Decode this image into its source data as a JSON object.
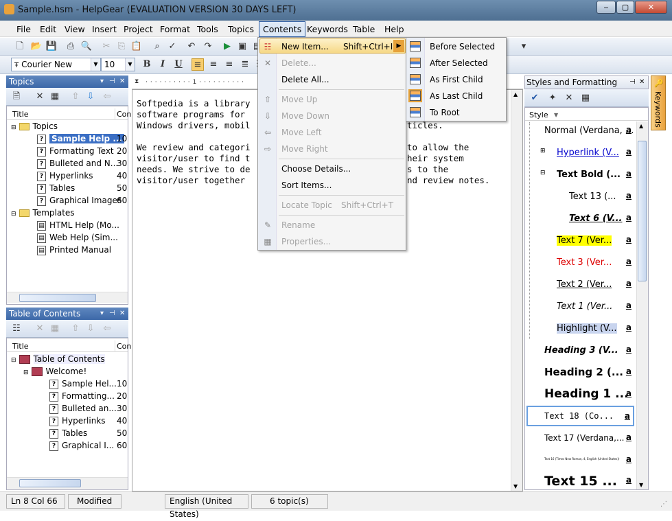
{
  "window": {
    "title": "Sample.hsm - HelpGear (EVALUATION VERSION 30 DAYS LEFT)",
    "min": "‒",
    "max": "▢",
    "close": "✕"
  },
  "menubar": [
    "File",
    "Edit",
    "View",
    "Insert",
    "Project",
    "Format",
    "Tools",
    "Topics",
    "Contents",
    "Keywords",
    "Table",
    "Help"
  ],
  "format_toolbar": {
    "font": "Courier New",
    "size": "10",
    "bold": "B",
    "italic": "I",
    "underline": "U"
  },
  "topics_panel": {
    "title": "Topics",
    "col_title": "Title",
    "col_con": "Con",
    "items": [
      {
        "label": "Topics",
        "num": ""
      },
      {
        "label": "Sample Help ...",
        "num": "10"
      },
      {
        "label": "Formatting Text",
        "num": "20"
      },
      {
        "label": "Bulleted and N...",
        "num": "30"
      },
      {
        "label": "Hyperlinks",
        "num": "40"
      },
      {
        "label": "Tables",
        "num": "50"
      },
      {
        "label": "Graphical Images",
        "num": "60"
      },
      {
        "label": "Templates",
        "num": ""
      },
      {
        "label": "HTML Help (Mo...",
        "num": ""
      },
      {
        "label": "Web Help (Sim...",
        "num": ""
      },
      {
        "label": "Printed Manual",
        "num": ""
      }
    ]
  },
  "toc_panel": {
    "title": "Table of Contents",
    "col_title": "Title",
    "col_con": "Con",
    "items": [
      {
        "label": "Table of Contents",
        "num": ""
      },
      {
        "label": "Welcome!",
        "num": ""
      },
      {
        "label": "Sample Hel...",
        "num": "10"
      },
      {
        "label": "Formatting...",
        "num": "20"
      },
      {
        "label": "Bulleted an...",
        "num": "30"
      },
      {
        "label": "Hyperlinks",
        "num": "40"
      },
      {
        "label": "Tables",
        "num": "50"
      },
      {
        "label": "Graphical I...",
        "num": "60"
      }
    ]
  },
  "editor": {
    "lines": [
      "Softpedia is a library",
      "software programs for",
      "Windows drivers, mobil",
      "",
      "We review and categori",
      "visitor/user to find t",
      "needs. We strive to de",
      "visitor/user together "
    ],
    "right_lines": [
      {
        "row": 2,
        "text": "ticles."
      },
      {
        "row": 4,
        "text": "to allow the"
      },
      {
        "row": 5,
        "text": "heir system"
      },
      {
        "row": 6,
        "text": "s to the"
      },
      {
        "row": 7,
        "text": "nd review notes."
      }
    ]
  },
  "contents_menu": {
    "items": [
      {
        "label": "New Item...",
        "shortcut": "Shift+Ctrl+I",
        "disabled": false
      },
      {
        "label": "Delete...",
        "shortcut": "",
        "disabled": true
      },
      {
        "label": "Delete All...",
        "shortcut": "",
        "disabled": false
      },
      {
        "label": "Move Up",
        "shortcut": "",
        "disabled": true
      },
      {
        "label": "Move Down",
        "shortcut": "",
        "disabled": true
      },
      {
        "label": "Move Left",
        "shortcut": "",
        "disabled": true
      },
      {
        "label": "Move Right",
        "shortcut": "",
        "disabled": true
      },
      {
        "label": "Choose Details...",
        "shortcut": "",
        "disabled": false
      },
      {
        "label": "Sort Items...",
        "shortcut": "",
        "disabled": false
      },
      {
        "label": "Locate Topic",
        "shortcut": "Shift+Ctrl+T",
        "disabled": true
      },
      {
        "label": "Rename",
        "shortcut": "",
        "disabled": true
      },
      {
        "label": "Properties...",
        "shortcut": "",
        "disabled": true
      }
    ]
  },
  "new_item_submenu": [
    "Before Selected",
    "After Selected",
    "As First Child",
    "As Last Child",
    "To Root"
  ],
  "styles_panel": {
    "title": "Styles and Formatting",
    "col": "Style",
    "side_tab": "Keywords",
    "styles": [
      {
        "label": "Normal (Verdana, ...",
        "color": "#000000"
      },
      {
        "label": "Hyperlink (V...",
        "color": "#0000cc"
      },
      {
        "label": "Text Bold (...",
        "color": "#000000"
      },
      {
        "label": "Text 13 (...",
        "color": "#000000"
      },
      {
        "label": "Text 6 (V...",
        "color": "#000000"
      },
      {
        "label": "Text 7 (Ver...",
        "color": "#000000",
        "bg": "#ffff00"
      },
      {
        "label": "Text 3 (Ver...",
        "color": "#dd0000"
      },
      {
        "label": "Text 2 (Ver...",
        "color": "#000000"
      },
      {
        "label": "Text 1 (Ver...",
        "color": "#000000"
      },
      {
        "label": "Highlight (V...",
        "color": "#000000",
        "bg": "#c8d4ee"
      },
      {
        "label": "Heading 3 (V...",
        "color": "#000000"
      },
      {
        "label": "Heading 2 (...",
        "color": "#000000"
      },
      {
        "label": "Heading 1 ...",
        "color": "#000000"
      },
      {
        "label": "Text 18 (Co...",
        "color": "#000000"
      },
      {
        "label": "Text 17 (Verdana,...",
        "color": "#000000"
      },
      {
        "label": "Text 16 (Times New Roman, 4, English (United States))",
        "color": "#000000"
      },
      {
        "label": "Text 15 ...",
        "color": "#000000"
      }
    ],
    "a_mark": "a"
  },
  "status": {
    "pos": "Ln 8 Col 66",
    "mod": "Modified",
    "lang": "English (United States)",
    "topics": "6 topic(s)"
  }
}
